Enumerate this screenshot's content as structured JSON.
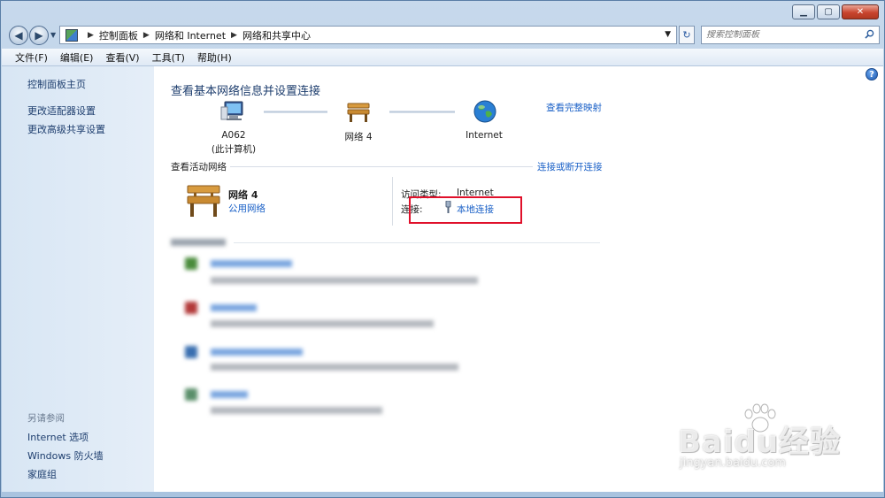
{
  "addressbar": {
    "crumbs": [
      "控制面板",
      "网络和 Internet",
      "网络和共享中心"
    ],
    "search_placeholder": "搜索控制面板"
  },
  "menu": [
    "文件(F)",
    "编辑(E)",
    "查看(V)",
    "工具(T)",
    "帮助(H)"
  ],
  "sidebar": {
    "top_links": [
      "控制面板主页",
      "更改适配器设置",
      "更改高级共享设置"
    ],
    "see_also_heading": "另请参阅",
    "see_also_links": [
      "Internet 选项",
      "Windows 防火墙",
      "家庭组"
    ]
  },
  "main": {
    "title": "查看基本网络信息并设置连接",
    "map": {
      "computer_name": "A062",
      "computer_sub": "(此计算机)",
      "network_name": "网络  4",
      "internet_label": "Internet",
      "full_map_link": "查看完整映射"
    },
    "active": {
      "section_title": "查看活动网络",
      "connect_link": "连接或断开连接",
      "network_name": "网络  4",
      "network_type_link": "公用网络",
      "access_type_label": "访问类型:",
      "access_type_value": "Internet",
      "connections_label": "连接:",
      "connection_link": "本地连接"
    }
  },
  "watermark": {
    "brand": "Baidu经验",
    "url": "jingyan.baidu.com"
  },
  "colors": {
    "link": "#1b61c7",
    "title": "#1e3e6e",
    "highlight": "#e0102a"
  }
}
